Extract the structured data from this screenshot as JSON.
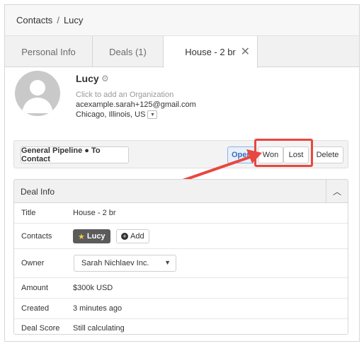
{
  "breadcrumb": {
    "root": "Contacts",
    "separator": "/",
    "current": "Lucy"
  },
  "tabs": [
    {
      "label": "Personal Info"
    },
    {
      "label": "Deals (1)"
    },
    {
      "label": "House - 2 br",
      "close": "✕"
    }
  ],
  "contact": {
    "name": "Lucy",
    "gear": "⚙",
    "organization_placeholder": "Click to add an Organization",
    "email": "acexample.sarah+125@gmail.com",
    "location": "Chicago, Illinois, US",
    "location_caret": "▼"
  },
  "pipeline": {
    "stage_label": "General Pipeline ● To Contact",
    "buttons": {
      "open": "Open",
      "won": "Won",
      "lost": "Lost",
      "delete": "Delete"
    }
  },
  "deal_info": {
    "title": "Deal Info",
    "collapse": "︿",
    "rows": {
      "title": {
        "label": "Title",
        "value": "House - 2 br"
      },
      "contacts": {
        "label": "Contacts",
        "tag": "Lucy",
        "star": "★",
        "add": "Add",
        "add_icon": "+"
      },
      "owner": {
        "label": "Owner",
        "value": "Sarah Nichlaev Inc.",
        "caret": "▼"
      },
      "amount": {
        "label": "Amount",
        "value": "$300k USD"
      },
      "created": {
        "label": "Created",
        "value": "3 minutes ago"
      },
      "deal_score": {
        "label": "Deal Score",
        "value": "Still calculating"
      }
    }
  },
  "colors": {
    "highlight": "#e8473f",
    "open_accent": "#3a6fb5"
  }
}
